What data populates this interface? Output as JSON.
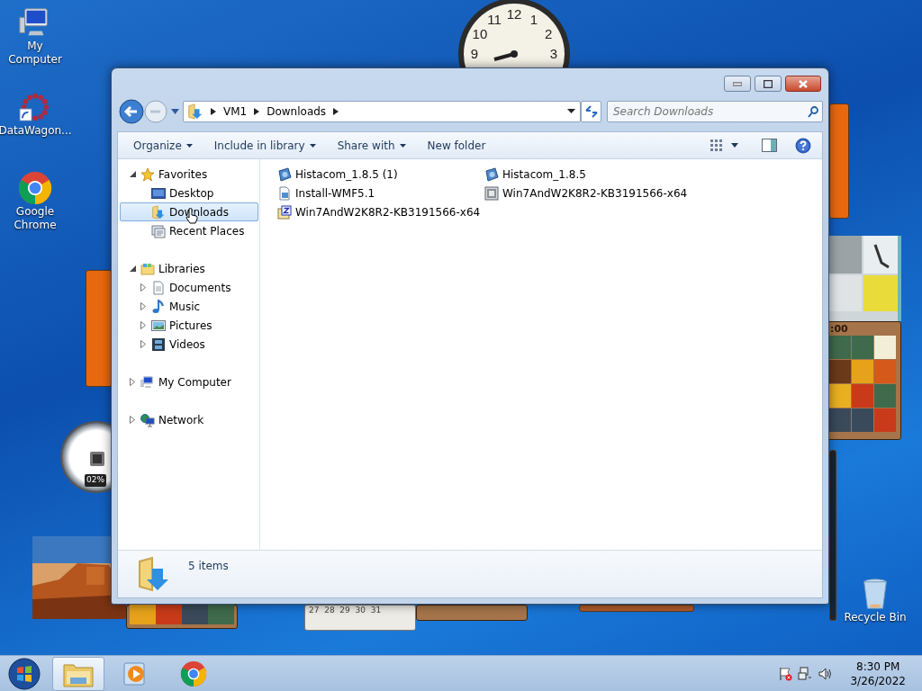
{
  "desktop_icons": [
    {
      "kind": "computer",
      "label": "My Computer"
    },
    {
      "kind": "shortcut",
      "label": "DataWagon..."
    },
    {
      "kind": "chrome",
      "label": "Google Chrome"
    },
    {
      "kind": "recycle",
      "label": "Recycle Bin"
    }
  ],
  "gadgets": {
    "clock_numerals": [
      "12",
      "1",
      "2",
      "3",
      "9",
      "10",
      "11"
    ],
    "cpu_reading": "02%",
    "puzzle_timer": ":00",
    "calendar_days": "27  28  29  30  31"
  },
  "window": {
    "breadcrumb": [
      "VM1",
      "Downloads"
    ],
    "search_placeholder": "Search Downloads",
    "toolbar": [
      {
        "label": "Organize",
        "dropdown": true
      },
      {
        "label": "Include in library",
        "dropdown": true
      },
      {
        "label": "Share with",
        "dropdown": true
      },
      {
        "label": "New folder",
        "dropdown": false
      }
    ],
    "nav": [
      {
        "label": "Favorites",
        "kind": "star",
        "expanded": true,
        "selected": false,
        "children": [
          {
            "label": "Desktop",
            "kind": "desktop",
            "selected": false
          },
          {
            "label": "Downloads",
            "kind": "downloads",
            "selected": true
          },
          {
            "label": "Recent Places",
            "kind": "recent",
            "selected": false
          }
        ]
      },
      {
        "label": "Libraries",
        "kind": "library",
        "expanded": true,
        "selected": false,
        "children": [
          {
            "label": "Documents",
            "kind": "documents",
            "expanded": false,
            "selected": false
          },
          {
            "label": "Music",
            "kind": "music",
            "expanded": false,
            "selected": false
          },
          {
            "label": "Pictures",
            "kind": "pictures",
            "expanded": false,
            "selected": false
          },
          {
            "label": "Videos",
            "kind": "videos",
            "expanded": false,
            "selected": false
          }
        ]
      },
      {
        "label": "My Computer",
        "kind": "computer",
        "expanded": false,
        "selected": false
      },
      {
        "label": "Network",
        "kind": "network",
        "expanded": false,
        "selected": false
      }
    ],
    "files": [
      {
        "kind": "installer",
        "name": "Histacom_1.8.5 (1)"
      },
      {
        "kind": "installer",
        "name": "Histacom_1.8.5"
      },
      {
        "kind": "script",
        "name": "Install-WMF5.1"
      },
      {
        "kind": "package",
        "name": "Win7AndW2K8R2-KB3191566-x64"
      },
      {
        "kind": "zip",
        "name": "Win7AndW2K8R2-KB3191566-x64"
      }
    ],
    "status": "5 items"
  },
  "taskbar": {
    "apps": [
      {
        "kind": "explorer",
        "active": true
      },
      {
        "kind": "media",
        "active": false
      },
      {
        "kind": "chrome",
        "active": false
      }
    ],
    "time": "8:30 PM",
    "date": "3/26/2022"
  }
}
